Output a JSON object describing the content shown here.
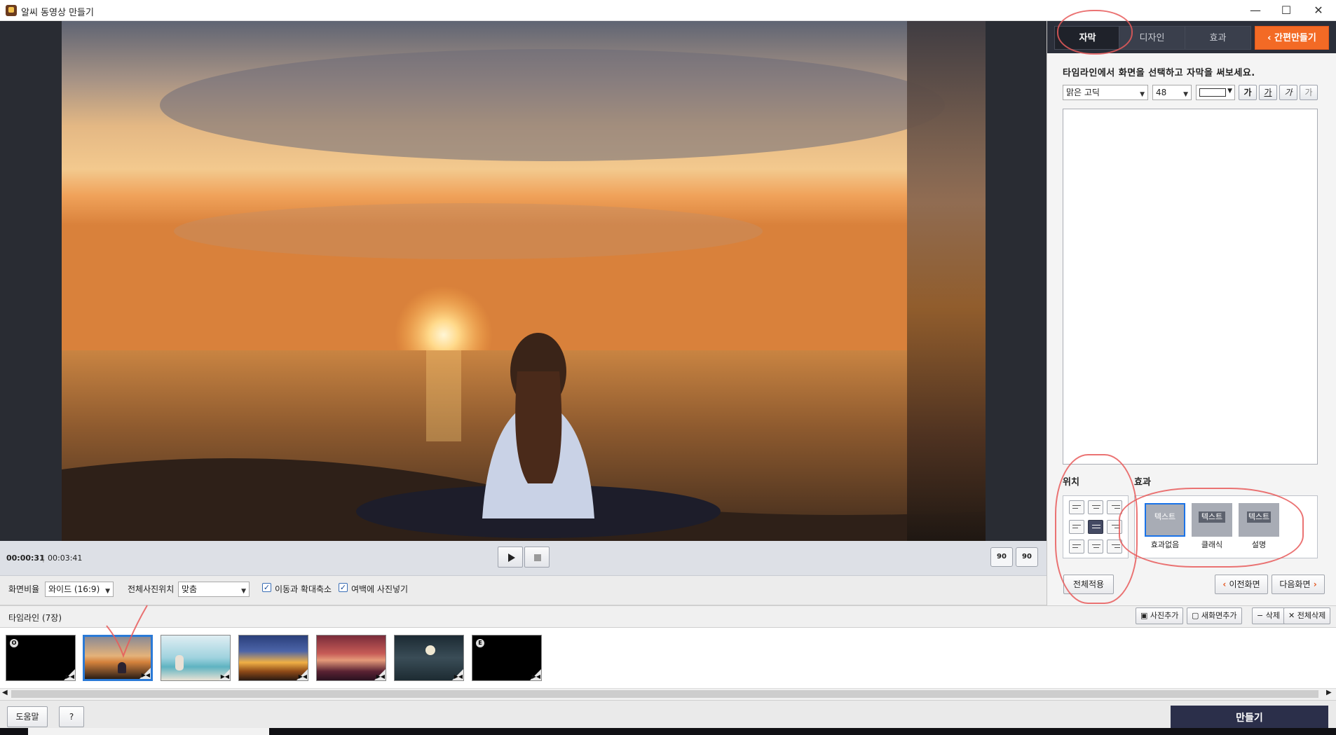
{
  "window": {
    "title": "알씨 동영상 만들기",
    "controls": {
      "minimize": "—",
      "maximize": "☐",
      "close": "✕"
    }
  },
  "playback": {
    "current_time": "00:00:31",
    "separator": "|",
    "total_time": "00:03:41",
    "play_icon": "play-icon",
    "stop_icon": "stop-icon",
    "rotate_left": "90",
    "rotate_right": "90"
  },
  "options": {
    "aspect_label": "화면비율",
    "aspect_value": "와이드 (16:9)",
    "photo_position_label": "전체사진위치",
    "photo_position_value": "맞춤",
    "move_zoom_label": "이동과 확대축소",
    "move_zoom_checked": true,
    "fill_margin_label": "여백에 사진넣기",
    "fill_margin_checked": true
  },
  "right_panel": {
    "tabs": [
      {
        "label": "자막",
        "active": true
      },
      {
        "label": "디자인",
        "active": false
      },
      {
        "label": "효과",
        "active": false
      }
    ],
    "quick_make_label": "간편만들기",
    "instruction": "타임라인에서 화면을 선택하고 자막을 써보세요.",
    "font_value": "맑은 고딕",
    "size_value": "48",
    "style_buttons": [
      "가",
      "가",
      "가",
      "가"
    ],
    "position_title": "위치",
    "effect_title": "효과",
    "effects": [
      {
        "chip": "텍스트",
        "label": "효과없음",
        "selected": true
      },
      {
        "chip": "텍스트",
        "label": "클래식",
        "selected": false
      },
      {
        "chip": "텍스트",
        "label": "설명",
        "selected": false
      }
    ],
    "apply_all_label": "전체적용",
    "prev_label": "이전화면",
    "next_label": "다음화면"
  },
  "timeline": {
    "title": "타임라인 (7장)",
    "buttons": [
      "사진추가",
      "새화면추가",
      "삭제",
      "전체삭제"
    ],
    "thumbnails": [
      {
        "badge": "O",
        "kind": "black"
      },
      {
        "badge": "",
        "kind": "sunset-meditation",
        "selected": true
      },
      {
        "badge": "",
        "kind": "beach-yoga"
      },
      {
        "badge": "",
        "kind": "dramatic-sky"
      },
      {
        "badge": "",
        "kind": "red-mountains"
      },
      {
        "badge": "",
        "kind": "moon-night"
      },
      {
        "badge": "E",
        "kind": "black"
      }
    ]
  },
  "bottom": {
    "help_label": "도움말",
    "question_label": "?",
    "make_label": "만들기"
  },
  "colors": {
    "accent_orange": "#f36a25",
    "dark_tab": "#2b2f3a",
    "selection_blue": "#2a7ad7",
    "make_button": "#2b2f4a"
  }
}
